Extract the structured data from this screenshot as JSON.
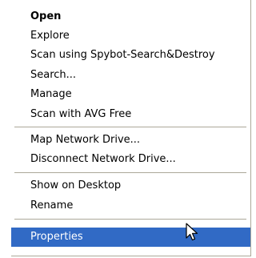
{
  "context_menu": {
    "items": [
      {
        "label": "Open"
      },
      {
        "label": "Explore"
      },
      {
        "label": "Scan using Spybot-Search&Destroy"
      },
      {
        "label": "Search..."
      },
      {
        "label": "Manage"
      },
      {
        "label": "Scan with AVG Free"
      },
      {
        "label": "Map Network Drive..."
      },
      {
        "label": "Disconnect Network Drive..."
      },
      {
        "label": "Show on Desktop"
      },
      {
        "label": "Rename"
      },
      {
        "label": "Properties"
      }
    ],
    "default_item": "Open",
    "highlighted_item": "Properties",
    "colors": {
      "highlight": "#316ac5",
      "highlight_text": "#ffffff",
      "separator": "#aca899",
      "background": "#ffffff"
    }
  }
}
